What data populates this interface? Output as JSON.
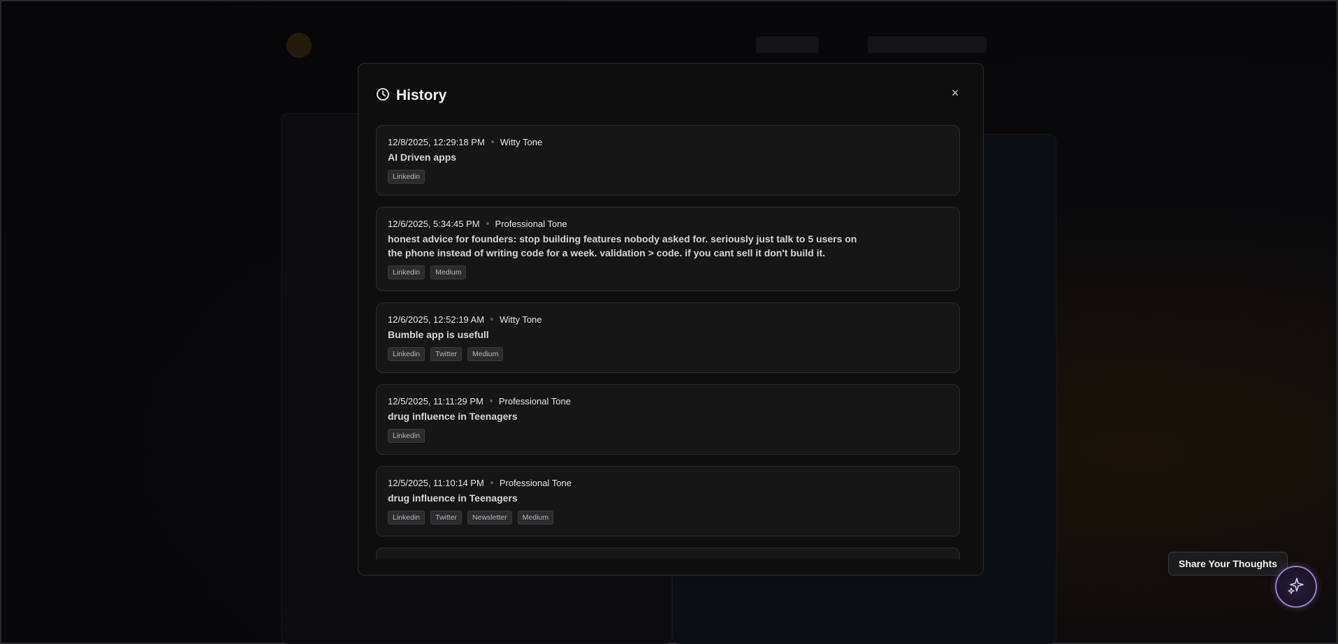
{
  "modal": {
    "title": "History",
    "close_label": "×"
  },
  "history": [
    {
      "timestamp": "12/8/2025, 12:29:18 PM",
      "tone": "Witty Tone",
      "topic": "AI Driven apps",
      "tags": [
        "Linkedin"
      ]
    },
    {
      "timestamp": "12/6/2025, 5:34:45 PM",
      "tone": "Professional Tone",
      "topic": "honest advice for founders: stop building features nobody asked for. seriously just talk to 5 users on the phone instead of writing code for a week. validation > code. if you cant sell it don't build it.",
      "tags": [
        "Linkedin",
        "Medium"
      ]
    },
    {
      "timestamp": "12/6/2025, 12:52:19 AM",
      "tone": "Witty Tone",
      "topic": "Bumble app is usefull",
      "tags": [
        "Linkedin",
        "Twitter",
        "Medium"
      ]
    },
    {
      "timestamp": "12/5/2025, 11:11:29 PM",
      "tone": "Professional Tone",
      "topic": "drug influence in Teenagers",
      "tags": [
        "Linkedin"
      ]
    },
    {
      "timestamp": "12/5/2025, 11:10:14 PM",
      "tone": "Professional Tone",
      "topic": "drug influence in Teenagers",
      "tags": [
        "Linkedin",
        "Twitter",
        "Newsletter",
        "Medium"
      ]
    }
  ],
  "feedback": {
    "label": "Share Your Thoughts",
    "button_icon": "sparkles-icon"
  },
  "colors": {
    "accent": "#9a7ad8",
    "card_bg": "#161617",
    "tag_bg": "#2c2c2e"
  }
}
